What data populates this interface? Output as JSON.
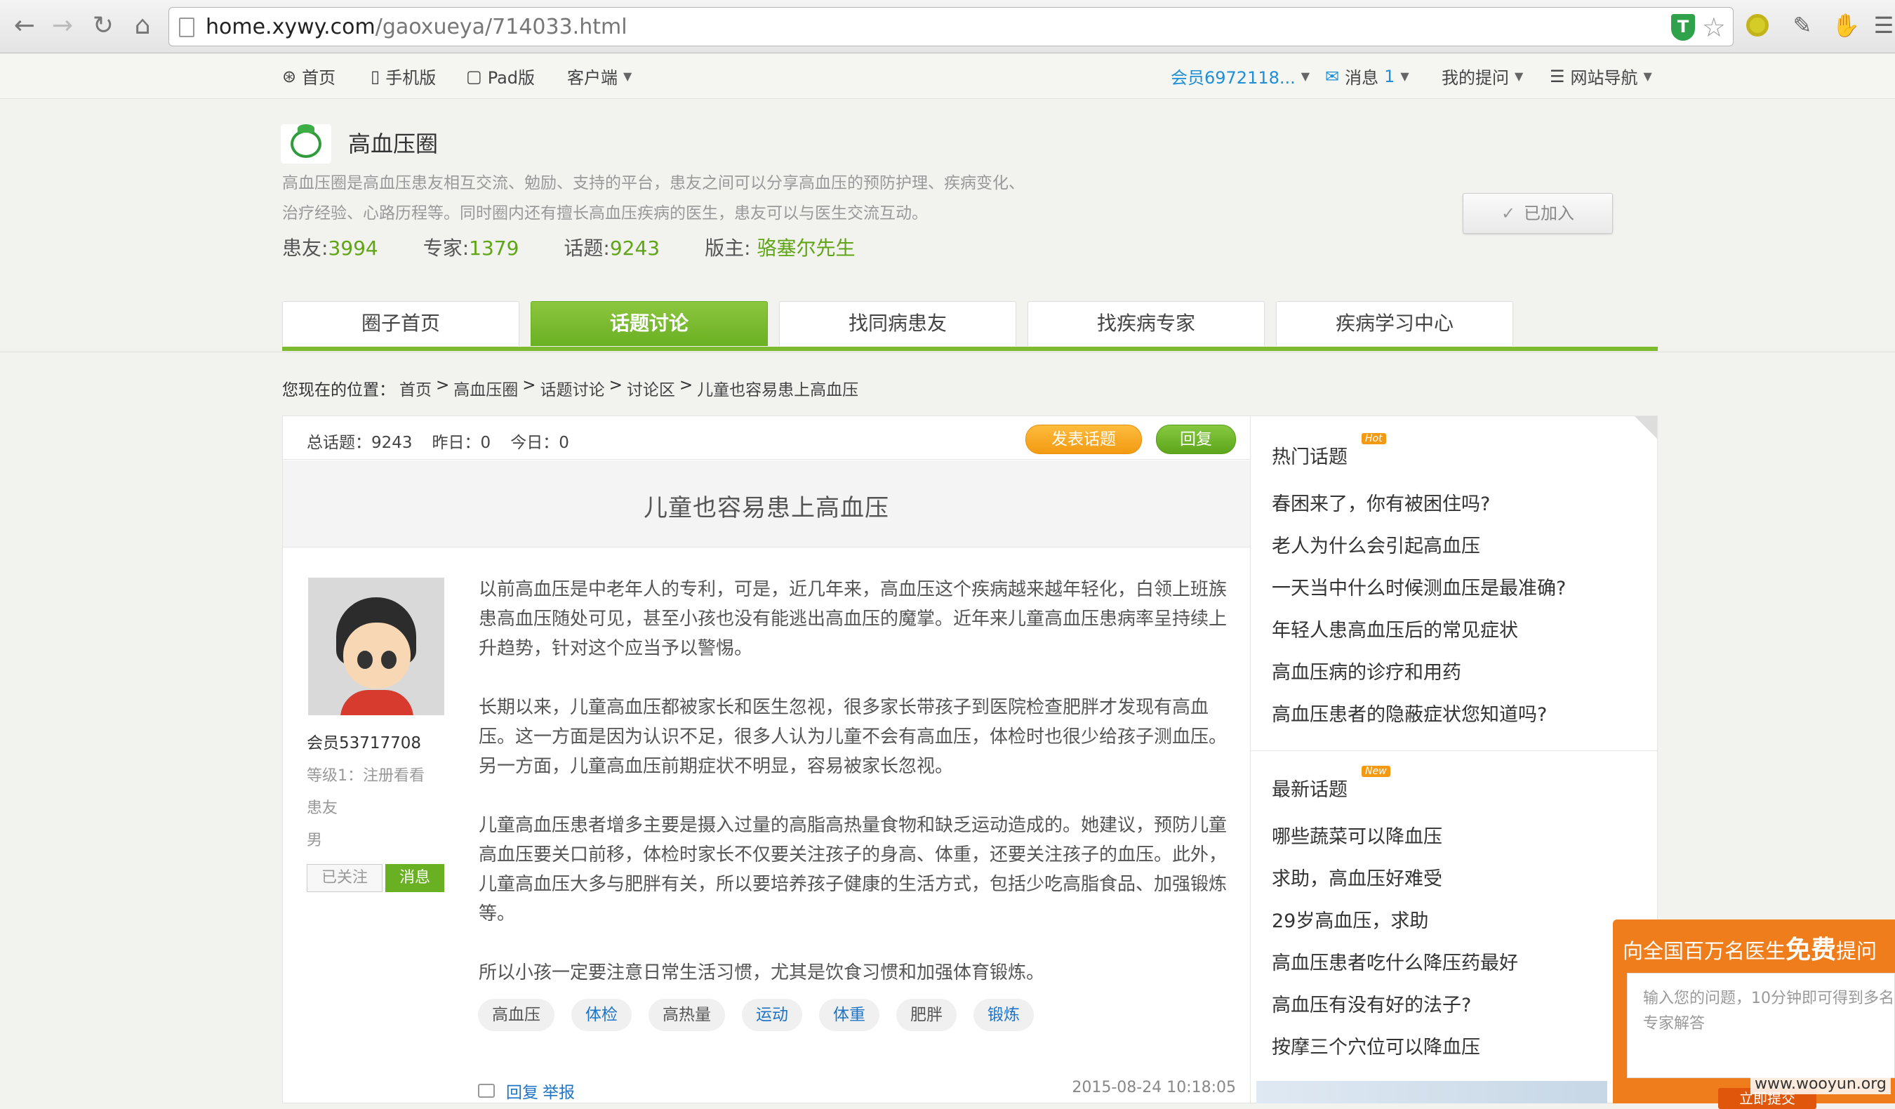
{
  "browser": {
    "url_host": "home.xywy.com",
    "url_path": "/gaoxueya/714033.html"
  },
  "topnav": {
    "home": "首页",
    "mobile": "手机版",
    "pad": "Pad版",
    "client": "客户端",
    "member": "会员6972118...",
    "messages": "消息",
    "message_count": "1",
    "my_questions": "我的提问",
    "site_nav": "网站导航"
  },
  "circle": {
    "name": "高血压圈",
    "description": "高血压圈是高血压患友相互交流、勉励、支持的平台，患友之间可以分享高血压的预防护理、疾病变化、治疗经验、心路历程等。同时圈内还有擅长高血压疾病的医生，患友可以与医生交流互动。",
    "stats": {
      "patients_label": "患友:",
      "patients": "3994",
      "experts_label": "专家:",
      "experts": "1379",
      "topics_label": "话题:",
      "topics": "9243",
      "moderator_label": "版主:",
      "moderator": "骆塞尔先生"
    },
    "joined_label": "已加入"
  },
  "tabs": [
    {
      "label": "圈子首页",
      "active": false
    },
    {
      "label": "话题讨论",
      "active": true
    },
    {
      "label": "找同病患友",
      "active": false
    },
    {
      "label": "找疾病专家",
      "active": false
    },
    {
      "label": "疾病学习中心",
      "active": false
    }
  ],
  "breadcrumb": {
    "prefix": "您现在的位置：",
    "items": [
      "首页",
      "高血压圈",
      "话题讨论",
      "讨论区",
      "儿童也容易患上高血压"
    ],
    "separator": ">"
  },
  "toolbar": {
    "total": "总话题：9243",
    "yesterday": "昨日：0",
    "today": "今日：0",
    "post_label": "发表话题",
    "reply_label": "回复"
  },
  "post": {
    "title": "儿童也容易患上高血压",
    "author": {
      "name": "会员53717708",
      "level": "等级1：注册看看",
      "role": "患友",
      "gender": "男",
      "followed_label": "已关注",
      "message_label": "消息"
    },
    "paragraphs": [
      "以前高血压是中老年人的专利，可是，近几年来，高血压这个疾病越来越年轻化，白领上班族患高血压随处可见，甚至小孩也没有能逃出高血压的魔掌。近年来儿童高血压患病率呈持续上升趋势，针对这个应当予以警惕。",
      "长期以来，儿童高血压都被家长和医生忽视，很多家长带孩子到医院检查肥胖才发现有高血压。这一方面是因为认识不足，很多人认为儿童不会有高血压，体检时也很少给孩子测血压。另一方面，儿童高血压前期症状不明显，容易被家长忽视。",
      "儿童高血压患者增多主要是摄入过量的高脂高热量食物和缺乏运动造成的。她建议，预防儿童高血压要关口前移，体检时家长不仅要关注孩子的身高、体重，还要关注孩子的血压。此外，儿童高血压大多与肥胖有关，所以要培养孩子健康的生活方式，包括少吃高脂食品、加强锻炼等。",
      "所以小孩一定要注意日常生活习惯，尤其是饮食习惯和加强体育锻炼。"
    ],
    "tags": [
      {
        "label": "高血压",
        "blue": false
      },
      {
        "label": "体检",
        "blue": true
      },
      {
        "label": "高热量",
        "blue": false
      },
      {
        "label": "运动",
        "blue": true
      },
      {
        "label": "体重",
        "blue": true
      },
      {
        "label": "肥胖",
        "blue": false
      },
      {
        "label": "锻炼",
        "blue": true
      }
    ],
    "reply_label": "回复",
    "report_label": "举报",
    "time": "2015-08-24 10:18:05"
  },
  "sidebar": {
    "hot_title": "热门话题",
    "hot_badge": "Hot",
    "hot": [
      "春困来了，你有被困住吗?",
      "老人为什么会引起高血压",
      "一天当中什么时候测血压是最准确?",
      "年轻人患高血压后的常见症状",
      "高血压病的诊疗和用药",
      "高血压患者的隐蔽症状您知道吗?"
    ],
    "new_title": "最新话题",
    "new_badge": "New",
    "latest": [
      "哪些蔬菜可以降血压",
      "求助，高血压好难受",
      "29岁高血压，求助",
      "高血压患者吃什么降压药最好",
      "高血压有没有好的法子?",
      "按摩三个穴位可以降血压"
    ]
  },
  "ask_widget": {
    "title_pre": "向全国百万名医生",
    "title_big": "免费",
    "title_post": "提问",
    "placeholder": "输入您的问题，10分钟即可得到多名专家解答",
    "button": "立即提交"
  },
  "watermark": "www.wooyun.org"
}
